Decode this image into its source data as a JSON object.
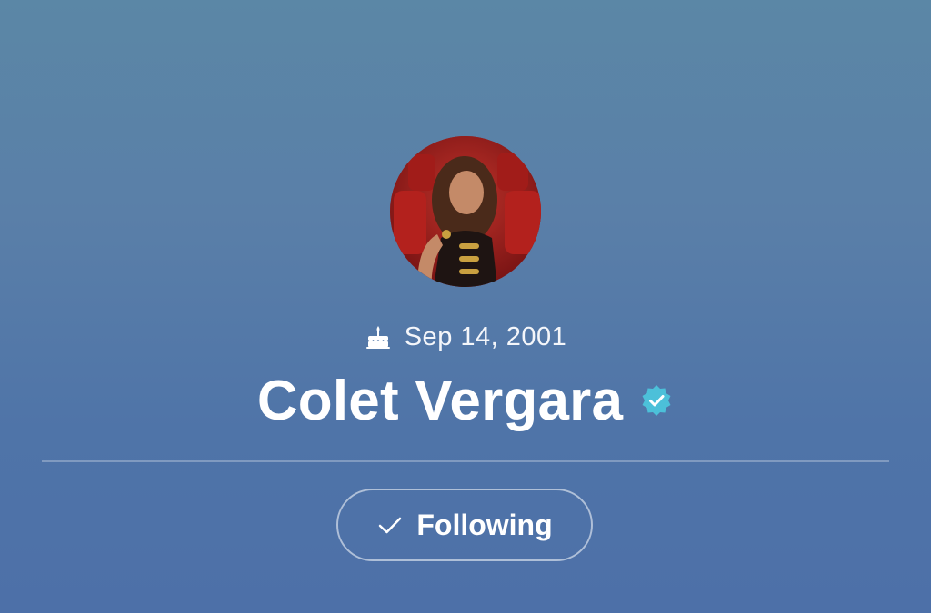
{
  "profile": {
    "birthday": "Sep 14, 2001",
    "name": "Colet Vergara",
    "verified": true,
    "avatar_icon": "profile-photo"
  },
  "actions": {
    "follow_label": "Following",
    "follow_icon": "check-icon"
  },
  "colors": {
    "background_top": "#5b87a6",
    "background_bottom": "#4d70a8",
    "verified_badge": "#4cc0d9",
    "text": "#ffffff"
  },
  "icons": {
    "birthday": "cake-icon",
    "verified": "verified-badge-icon"
  }
}
